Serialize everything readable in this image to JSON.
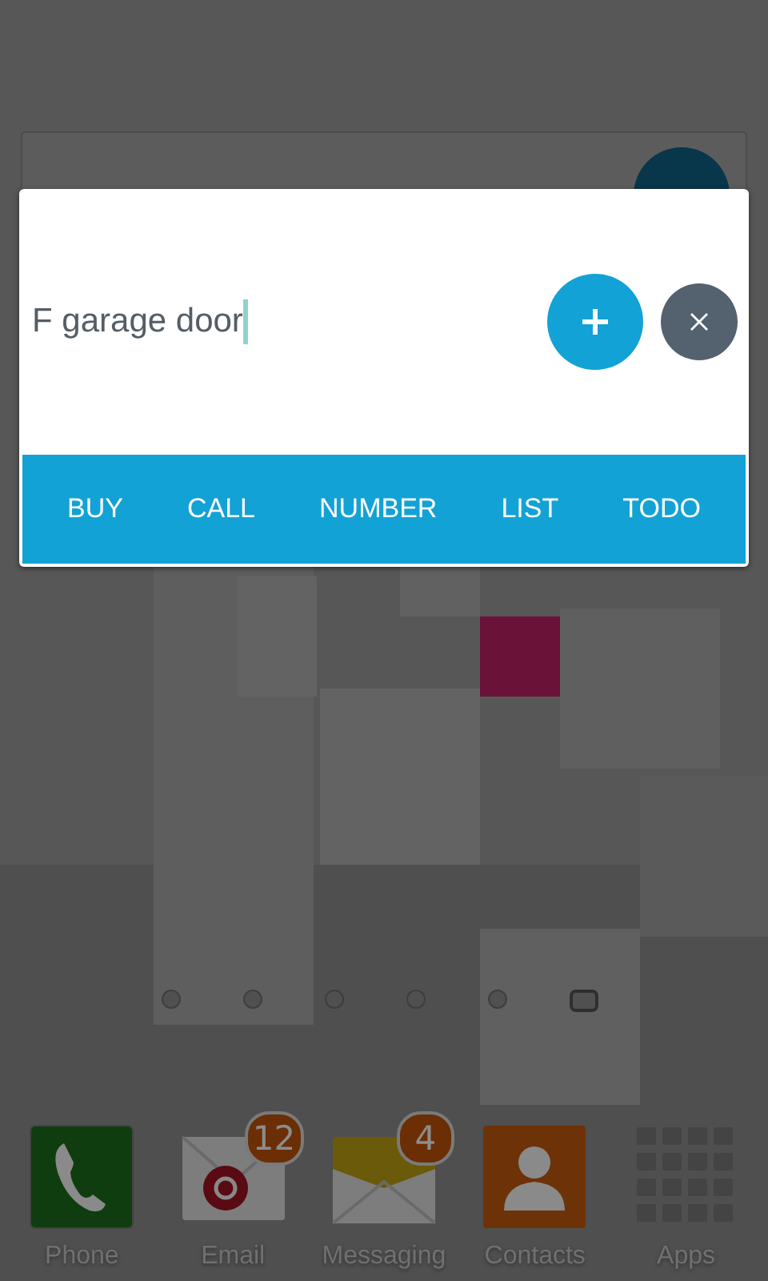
{
  "dialog": {
    "input_value": "F garage door",
    "tags": [
      {
        "label": "BUY"
      },
      {
        "label": "CALL"
      },
      {
        "label": "NUMBER"
      },
      {
        "label": "LIST"
      },
      {
        "label": "TODO"
      }
    ]
  },
  "page_indicator": [
    {
      "selected": false
    },
    {
      "selected": false
    },
    {
      "selected": false
    },
    {
      "selected": false
    },
    {
      "selected": false
    },
    {
      "selected": true
    }
  ],
  "dock": [
    {
      "kind": "phone",
      "label": "Phone"
    },
    {
      "kind": "email",
      "label": "Email",
      "badge": "12"
    },
    {
      "kind": "messaging",
      "label": "Messaging",
      "badge": "4"
    },
    {
      "kind": "contacts",
      "label": "Contacts"
    },
    {
      "kind": "apps",
      "label": "Apps"
    }
  ]
}
